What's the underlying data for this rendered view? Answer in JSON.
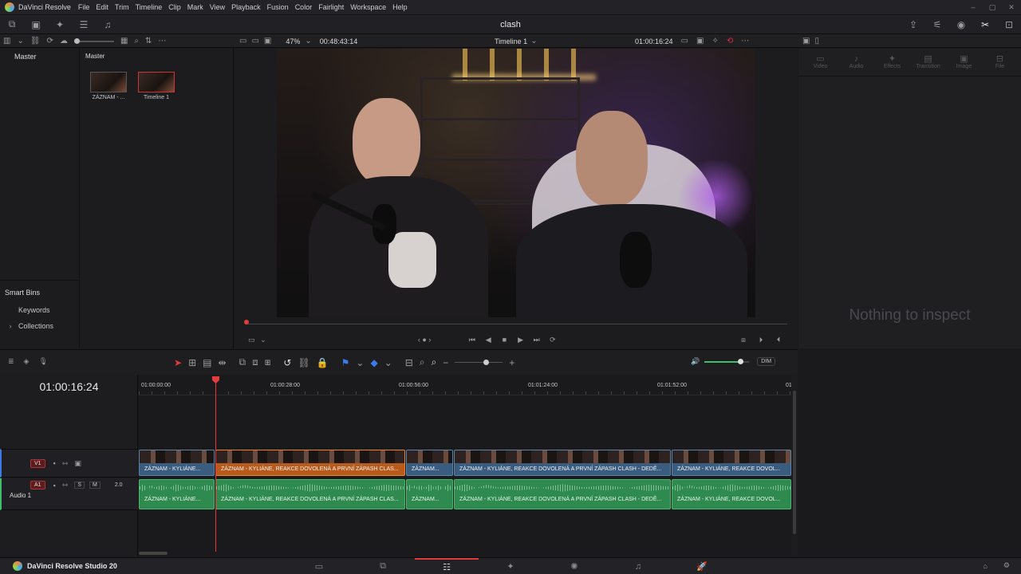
{
  "menubar": {
    "app_name": "DaVinci Resolve",
    "menus": [
      "File",
      "Edit",
      "Trim",
      "Timeline",
      "Clip",
      "Mark",
      "View",
      "Playback",
      "Fusion",
      "Color",
      "Fairlight",
      "Workspace",
      "Help"
    ],
    "window_controls": [
      "–",
      "▢",
      "✕"
    ]
  },
  "toolbar": {
    "project_title": "clash"
  },
  "viewer_bar": {
    "zoom": "47%",
    "source_timecode": "00:48:43:14",
    "timeline_name": "Timeline 1",
    "record_timecode": "01:00:16:24"
  },
  "media_pool": {
    "root_label": "Master",
    "bin_header": "Master",
    "clips": [
      {
        "name": "ZÁZNAM - ..."
      },
      {
        "name": "Timeline 1"
      }
    ],
    "smart_bins": {
      "title": "Smart Bins",
      "items": [
        "Keywords",
        "Collections"
      ]
    }
  },
  "inspector": {
    "tabs": [
      "Video",
      "Audio",
      "Effects",
      "Transition",
      "Image",
      "File"
    ],
    "empty_message": "Nothing to inspect"
  },
  "timeline": {
    "timecode": "01:00:16:24",
    "ruler_marks": [
      "01:00:00:00",
      "01:00:28:00",
      "01:00:56:00",
      "01:01:24:00",
      "01:01:52:00",
      "01"
    ],
    "playhead_fraction": 0.117,
    "audio_volume_fraction": 0.82,
    "dim_label": "DIM",
    "tracks": {
      "video": {
        "id": "V1"
      },
      "audio": {
        "id": "A1",
        "name": "Audio 1",
        "solo": "S",
        "mute": "M",
        "channels": "2.0"
      }
    },
    "video_clips": [
      {
        "label": "ZÁZNAM - KYLIÁNE...",
        "selected": false
      },
      {
        "label": "ZÁZNAM - KYLIÁNE, REAKCE DOVOLENÁ A PRVNÍ ZÁPASH CLAS...",
        "selected": true
      },
      {
        "label": "ZÁZNAM...",
        "selected": false
      },
      {
        "label": "ZÁZNAM - KYLIÁNE, REAKCE DOVOLENÁ A PRVNÍ ZÁPASH CLASH - DEDĚ...",
        "selected": false
      },
      {
        "label": "ZÁZNAM - KYLIÁNE, REAKCE DOVOL...",
        "selected": false
      }
    ],
    "audio_clips": [
      {
        "label": "ZÁZNAM - KYLIÁNE..."
      },
      {
        "label": "ZÁZNAM - KYLIÁNE, REAKCE DOVOLENÁ A PRVNÍ ZÁPASH CLAS..."
      },
      {
        "label": "ZÁZNAM..."
      },
      {
        "label": "ZÁZNAM - KYLIÁNE, REAKCE DOVOLENÁ A PRVNÍ ZÁPASH CLASH - DEDĚ..."
      },
      {
        "label": "ZÁZNAM - KYLIÁNE, REAKCE DOVOL..."
      }
    ]
  },
  "pagebar": {
    "brand": "DaVinci Resolve Studio 20",
    "active_page": "edit"
  },
  "colors": {
    "accent_red": "#e23c3c",
    "video_clip": "#3a5c7e",
    "selected_clip": "#b85b1a",
    "audio_clip": "#2e8a4f"
  }
}
